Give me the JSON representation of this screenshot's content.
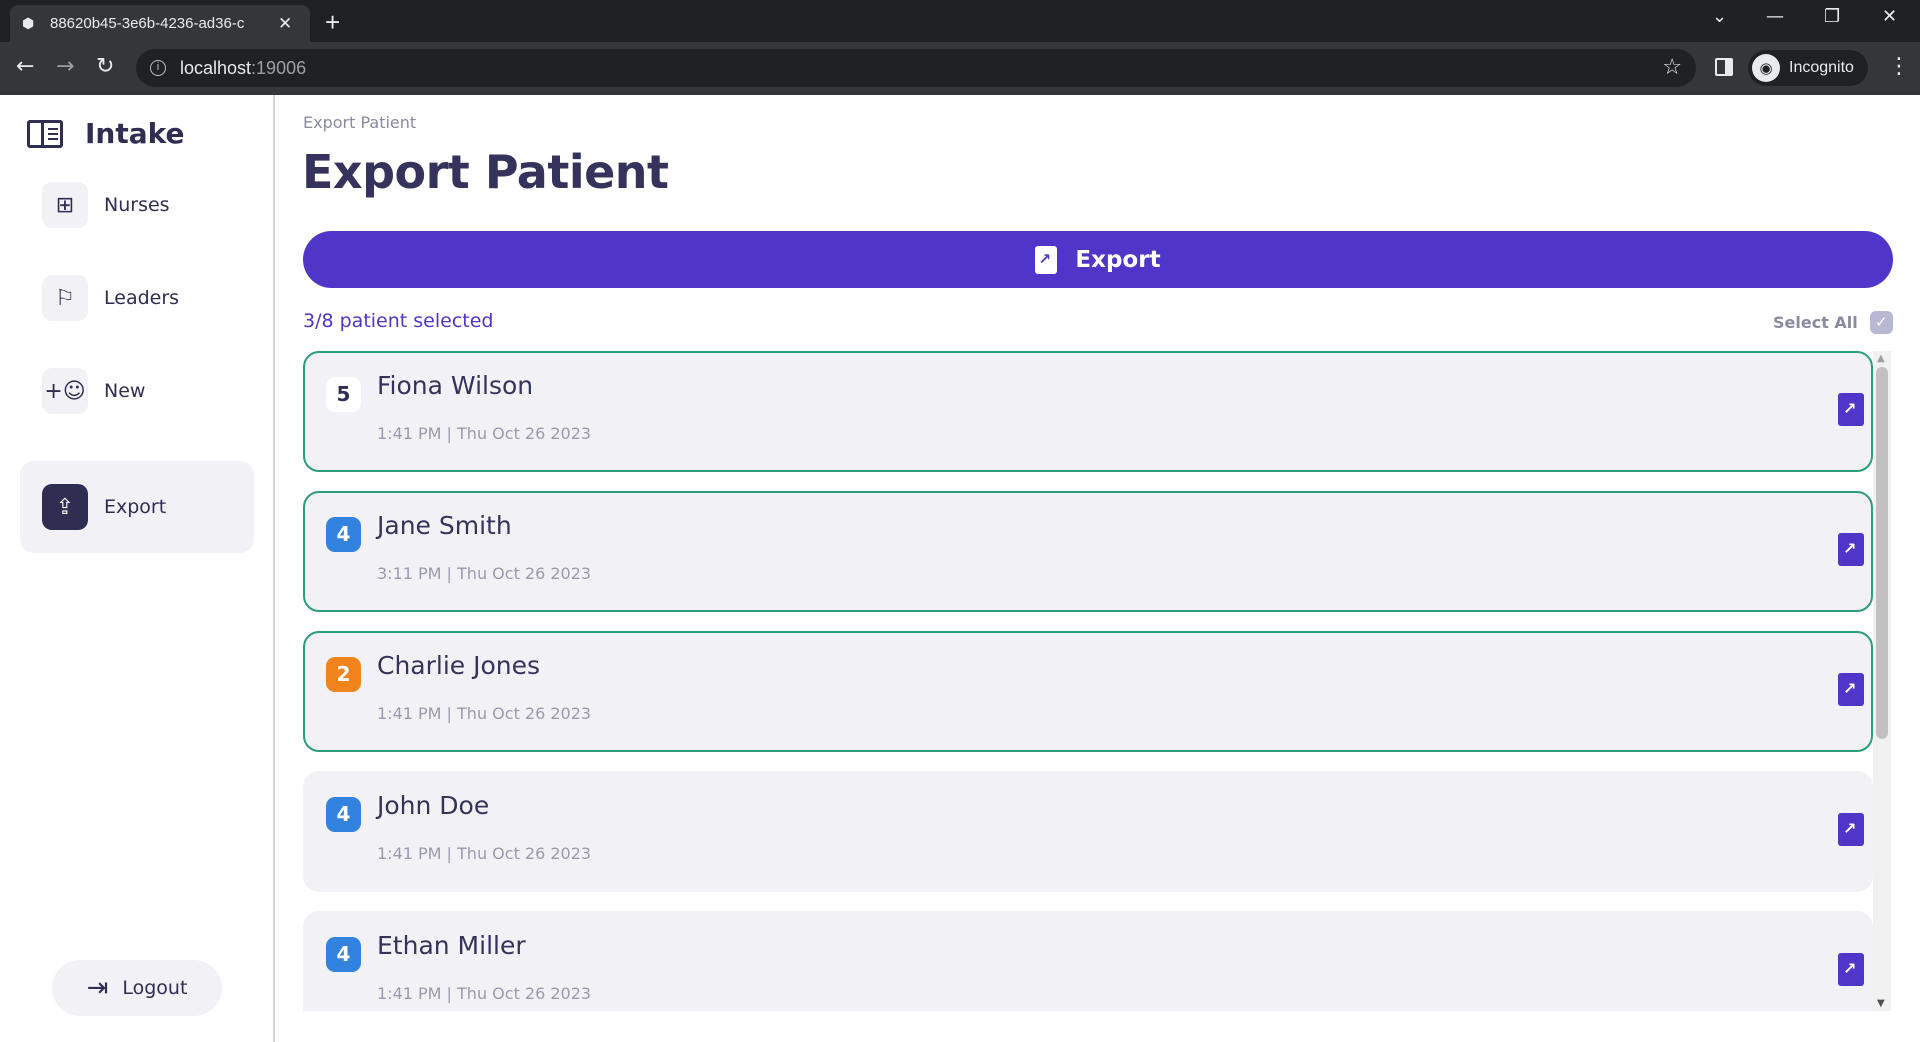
{
  "browser": {
    "tab_title": "88620b45-3e6b-4236-ad36-c",
    "url_host": "localhost",
    "url_port": ":19006",
    "profile_label": "Incognito"
  },
  "sidebar": {
    "brand": "Intake",
    "items": [
      {
        "label": "Nurses",
        "icon": "medical-cross-icon",
        "active": false
      },
      {
        "label": "Leaders",
        "icon": "flag-icon",
        "active": false
      },
      {
        "label": "New",
        "icon": "add-user-icon",
        "active": false
      },
      {
        "label": "Export",
        "icon": "file-export-icon",
        "active": true
      }
    ],
    "logout_label": "Logout"
  },
  "main": {
    "breadcrumb": "Export Patient",
    "title": "Export Patient",
    "export_button_label": "Export",
    "selected_count": "3/8 patient selected",
    "select_all_label": "Select All",
    "select_all_checked": true,
    "patients": [
      {
        "level": "5",
        "name": "Fiona Wilson",
        "meta": "1:41 PM  |  Thu Oct 26 2023",
        "selected": true,
        "badge_color": "#ffffff"
      },
      {
        "level": "4",
        "name": "Jane Smith",
        "meta": "3:11 PM  |  Thu Oct 26 2023",
        "selected": true,
        "badge_color": "#3282e0"
      },
      {
        "level": "2",
        "name": "Charlie Jones",
        "meta": "1:41 PM  |  Thu Oct 26 2023",
        "selected": true,
        "badge_color": "#f2841e"
      },
      {
        "level": "4",
        "name": "John Doe",
        "meta": "1:41 PM  |  Thu Oct 26 2023",
        "selected": false,
        "badge_color": "#3282e0"
      },
      {
        "level": "4",
        "name": "Ethan Miller",
        "meta": "1:41 PM  |  Thu Oct 26 2023",
        "selected": false,
        "badge_color": "#3282e0"
      }
    ]
  },
  "colors": {
    "primary": "#4f35c8",
    "dark_navy": "#2f2d52",
    "selected_border": "#2e9c78",
    "card_bg": "#f2f2f6"
  }
}
